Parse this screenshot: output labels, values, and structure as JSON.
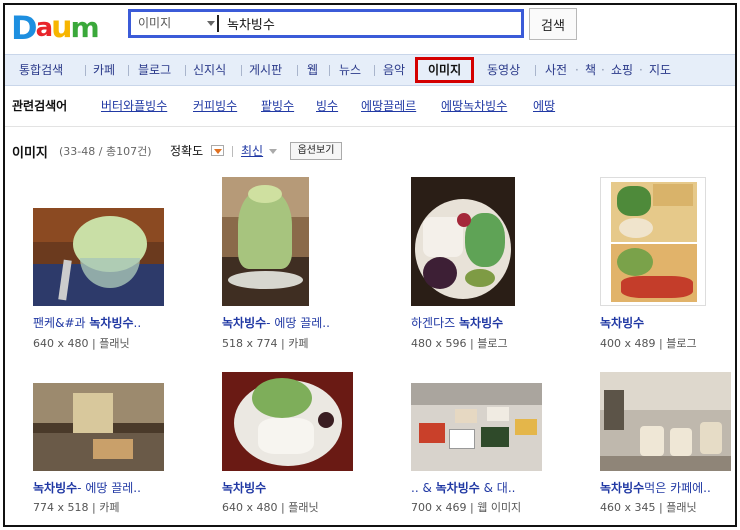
{
  "header": {
    "logo": [
      "D",
      "a",
      "u",
      "m"
    ],
    "logo_colors": [
      "#1d8fe0",
      "#e8252b",
      "#f7b500",
      "#3aa83a"
    ],
    "search_category": "이미지",
    "search_query": "녹차빙수",
    "search_button": "검색"
  },
  "tabs": {
    "items": [
      "통합검색",
      "카페",
      "블로그",
      "신지식",
      "게시판",
      "웹",
      "뉴스",
      "음악",
      "이미지",
      "동영상"
    ],
    "extra": [
      "사전",
      "책",
      "쇼핑",
      "지도"
    ],
    "active": "이미지"
  },
  "related": {
    "title": "관련검색어",
    "links": [
      "버터와플빙수",
      "커피빙수",
      "팥빙수",
      "빙수",
      "에땅끌레르",
      "에땅녹차빙수",
      "에땅"
    ]
  },
  "results": {
    "title": "이미지",
    "count": "(33-48 / 총107건)",
    "sort_accuracy": "정확도",
    "sort_recent": "최신",
    "options_button": "옵션보기",
    "items": [
      {
        "caption_prefix": "팬케&#과 ",
        "caption_bold": "녹차빙수",
        "caption_suffix": "..",
        "size": "640 x 480",
        "source": "플래닛"
      },
      {
        "caption_prefix": "",
        "caption_bold": "녹차빙수",
        "caption_suffix": "- 에땅 끌레..",
        "size": "518 x 774",
        "source": "카페"
      },
      {
        "caption_prefix": "하겐다즈 ",
        "caption_bold": "녹차빙수",
        "caption_suffix": "",
        "size": "480 x 596",
        "source": "블로그"
      },
      {
        "caption_prefix": "",
        "caption_bold": "녹차빙수",
        "caption_suffix": "",
        "size": "400 x 489",
        "source": "블로그"
      },
      {
        "caption_prefix": "",
        "caption_bold": "녹차빙수",
        "caption_suffix": "- 에땅 끌레..",
        "size": "774 x 518",
        "source": "카페"
      },
      {
        "caption_prefix": "",
        "caption_bold": "녹차빙수",
        "caption_suffix": "",
        "size": "640 x 480",
        "source": "플래닛"
      },
      {
        "caption_prefix": ".. & ",
        "caption_bold": "녹차빙수",
        "caption_suffix": " & 대..",
        "size": "700 x 469",
        "source": "웹 이미지"
      },
      {
        "caption_prefix": "",
        "caption_bold": "녹차빙수",
        "caption_suffix": "먹은 카페에..",
        "size": "460 x 345",
        "source": "플래닛"
      }
    ]
  }
}
